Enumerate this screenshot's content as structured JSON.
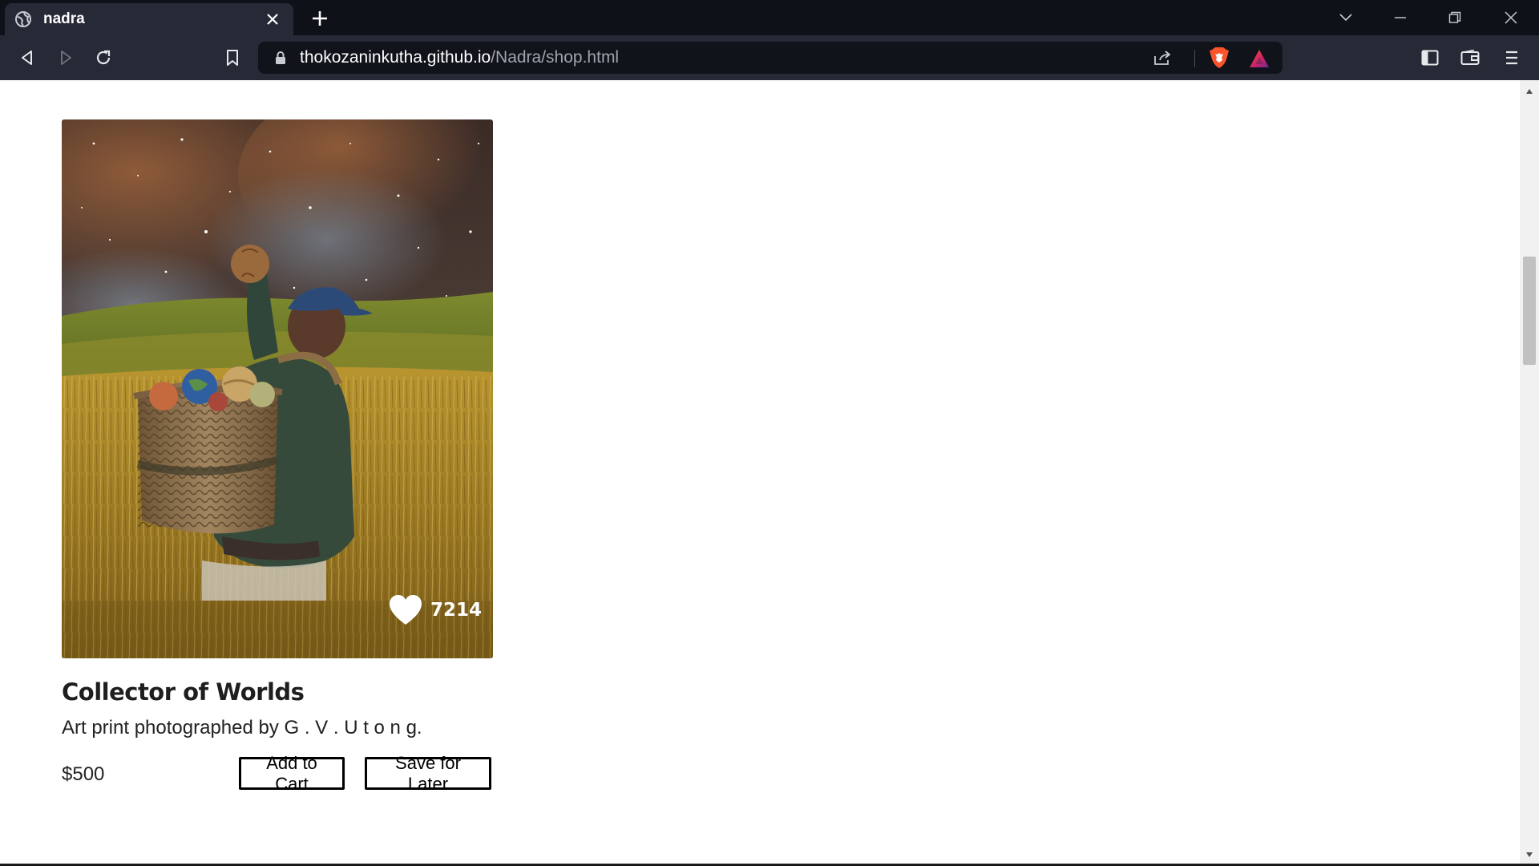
{
  "browser": {
    "tab_title": "nadra",
    "url_host": "thokozaninkutha.github.io",
    "url_path": "/Nadra/shop.html",
    "theme_color": "#262a36",
    "titlebar_color": "#0f1118"
  },
  "product": {
    "title": "Collector of Worlds",
    "description": "Art print photographed by  G . V . U  t o n g.",
    "price": "$500",
    "likes": "7214",
    "image_icon": "artwork-image"
  },
  "actions": {
    "add_to_cart": "Add to Cart",
    "save_for_later": "Save for Later"
  }
}
